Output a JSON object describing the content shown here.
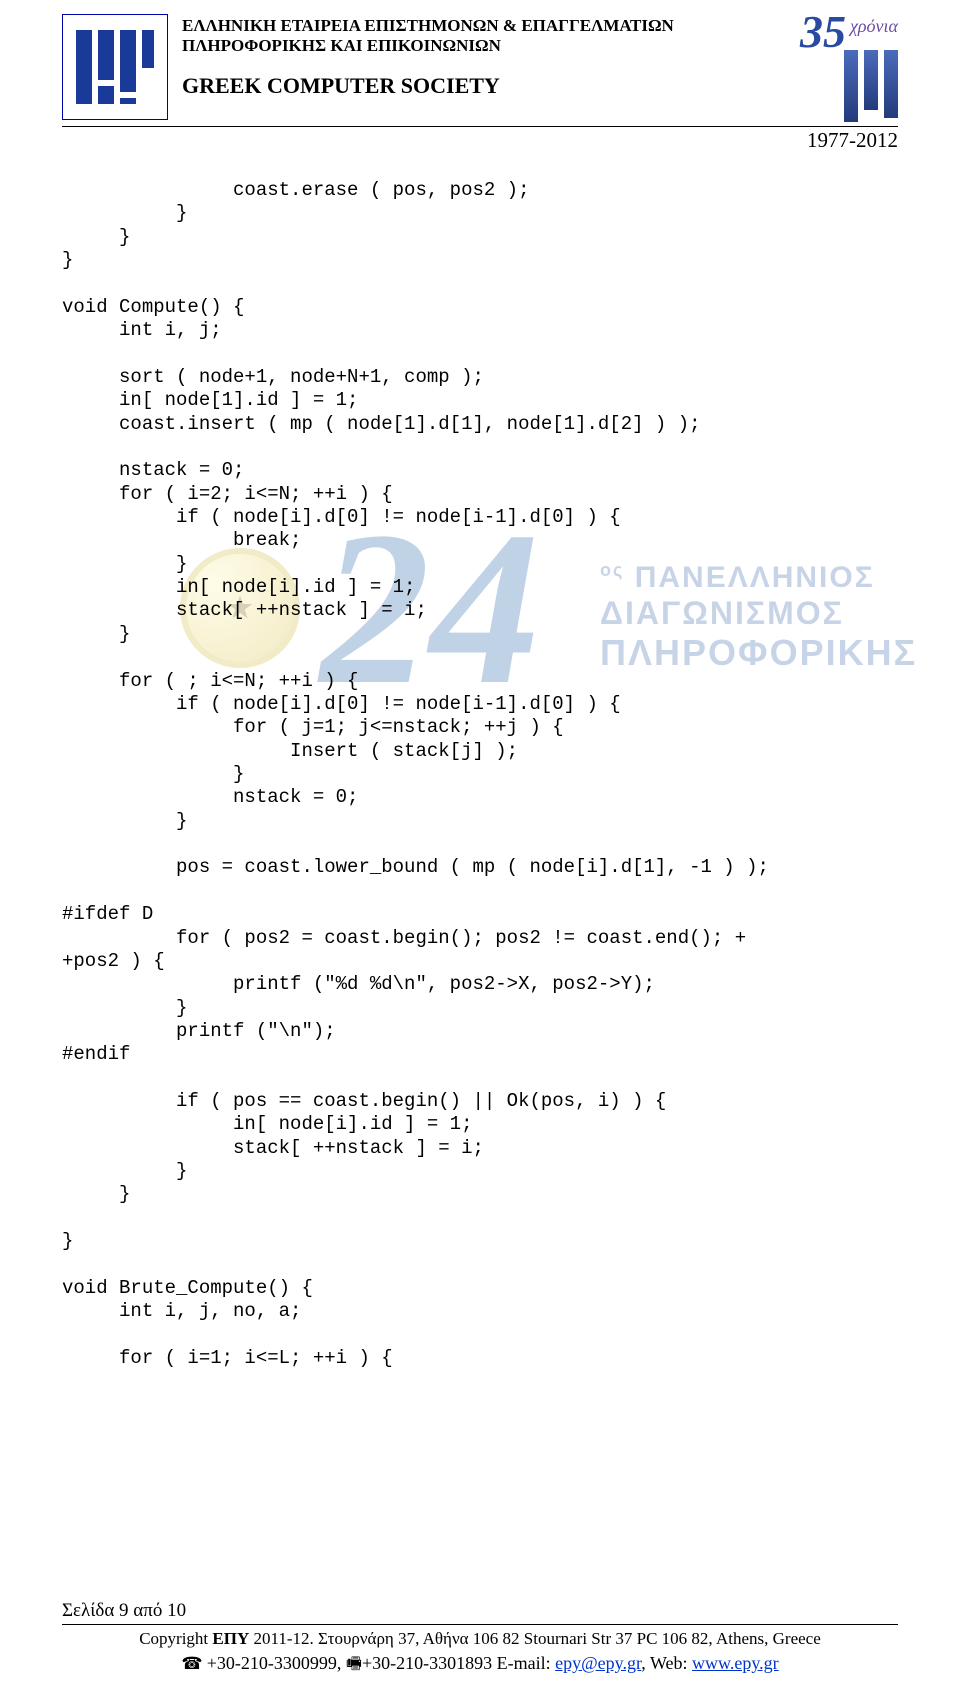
{
  "header": {
    "greek_line1": "ΕΛΛΗΝΙΚΗ ΕΤΑΙΡΕΙΑ ΕΠΙΣΤΗΜΟΝΩΝ & ΕΠΑΓΓΕΛΜΑΤΙΩΝ",
    "greek_line2": "ΠΛΗΡΟΦΟΡΙΚΗΣ ΚΑΙ ΕΠΙΚΟΙΝΩΝΙΩΝ",
    "english": "GREEK COMPUTER SOCIETY",
    "anniv_number": "35",
    "anniv_word": "χρόνια",
    "years": "1977-2012"
  },
  "watermark": {
    "num": "24",
    "line1_prefix": "ος",
    "line1": "ΠΑΝΕΛΛΗΝΙΟΣ",
    "line2": "ΔΙΑΓΩΝΙΣΜΟΣ",
    "line3": "ΠΛΗΡΟΦΟΡΙΚΗΣ"
  },
  "code": "               coast.erase ( pos, pos2 );\n          }\n     }\n}\n\nvoid Compute() {\n     int i, j;\n\n     sort ( node+1, node+N+1, comp );\n     in[ node[1].id ] = 1;\n     coast.insert ( mp ( node[1].d[1], node[1].d[2] ) );\n\n     nstack = 0;\n     for ( i=2; i<=N; ++i ) {\n          if ( node[i].d[0] != node[i-1].d[0] ) {\n               break;\n          }\n          in[ node[i].id ] = 1;\n          stack[ ++nstack ] = i;\n     }\n\n     for ( ; i<=N; ++i ) {\n          if ( node[i].d[0] != node[i-1].d[0] ) {\n               for ( j=1; j<=nstack; ++j ) {\n                    Insert ( stack[j] );\n               }\n               nstack = 0;\n          }\n\n          pos = coast.lower_bound ( mp ( node[i].d[1], -1 ) );\n\n#ifdef D\n          for ( pos2 = coast.begin(); pos2 != coast.end(); +\n+pos2 ) {\n               printf (\"%d %d\\n\", pos2->X, pos2->Y);\n          }\n          printf (\"\\n\");\n#endif\n\n          if ( pos == coast.begin() || Ok(pos, i) ) {\n               in[ node[i].id ] = 1;\n               stack[ ++nstack ] = i;\n          }\n     }\n\n}\n\nvoid Brute_Compute() {\n     int i, j, no, a;\n\n     for ( i=1; i<=L; ++i ) {",
  "footer": {
    "page": "Σελίδα 9 από 10",
    "copyright_prefix": "Copyright ",
    "copyright_bold": "ΕΠΥ",
    "copyright_rest": " 2011-12. Στουρνάρη 37, Αθήνα 106 82 Stournari Str 37 PC 106 82, Athens, Greece",
    "phone": "+30-210-3300999, ",
    "fax": "+30-210-3301893 E-mail: ",
    "email": "epy@epy.gr",
    "web_label": ", Web: ",
    "web": "www.epy.gr"
  }
}
